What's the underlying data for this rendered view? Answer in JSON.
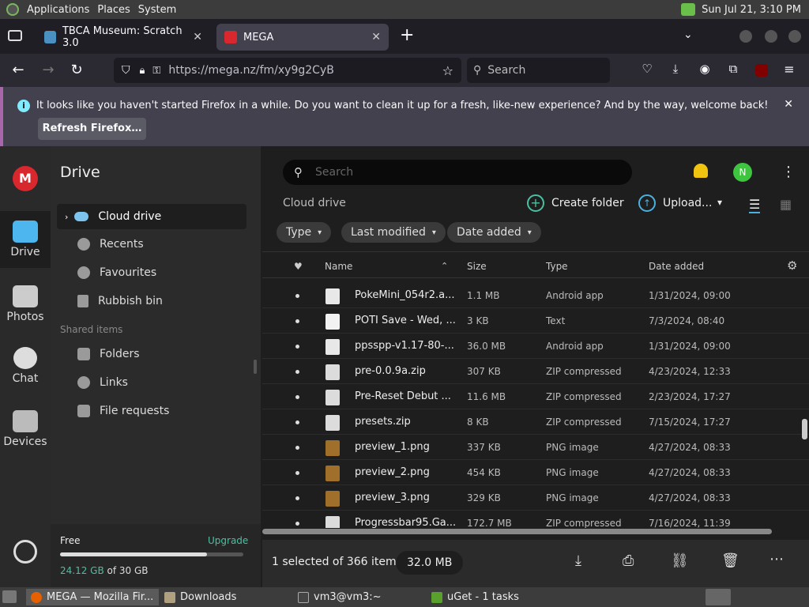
{
  "top_panel": {
    "menus": [
      "Applications",
      "Places",
      "System"
    ],
    "clock": "Sun Jul 21,  3:10 PM"
  },
  "tabs": [
    {
      "title": "TBCA Museum: Scratch 3.0",
      "favicon_color": "#4a90c2"
    },
    {
      "title": "MEGA",
      "favicon_color": "#d9272e"
    }
  ],
  "nav": {
    "url": "https://mega.nz/fm/xy9g2CyB",
    "search_placeholder": "Search"
  },
  "notification": {
    "message": "It looks like you haven't started Firefox in a while. Do you want to clean it up for a fresh, like-new experience? And by the way, welcome back!",
    "button": "Refresh Firefox…"
  },
  "mega": {
    "accent": "#d9272e",
    "iconbar": [
      "Drive",
      "Photos",
      "Chat",
      "Devices"
    ],
    "sidebar_title": "Drive",
    "sidebar_items": [
      "Cloud drive",
      "Recents",
      "Favourites",
      "Rubbish bin"
    ],
    "shared_header": "Shared items",
    "shared_items": [
      "Folders",
      "Links",
      "File requests"
    ],
    "storage": {
      "plan": "Free",
      "upgrade": "Upgrade",
      "used": "24.12 GB",
      "of": "of 30 GB",
      "fraction": 0.8
    },
    "search_placeholder": "Search",
    "avatar_letter": "N",
    "breadcrumb": "Cloud drive",
    "create_folder": "Create folder",
    "upload": "Upload...",
    "filters": [
      "Type",
      "Last modified",
      "Date added"
    ],
    "columns": {
      "name": "Name",
      "size": "Size",
      "type": "Type",
      "date": "Date added"
    },
    "files": [
      {
        "name": "PokeMini_054r2.a...",
        "size": "1.1 MB",
        "type": "Android app",
        "date": "1/31/2024, 09:00",
        "icon": "android"
      },
      {
        "name": "POTI Save - Wed, ...",
        "size": "3 KB",
        "type": "Text",
        "date": "7/3/2024, 08:40",
        "icon": "text"
      },
      {
        "name": "ppsspp-v1.17-80-...",
        "size": "36.0 MB",
        "type": "Android app",
        "date": "1/31/2024, 09:00",
        "icon": "android"
      },
      {
        "name": "pre-0.0.9a.zip",
        "size": "307 KB",
        "type": "ZIP compressed",
        "date": "4/23/2024, 12:33",
        "icon": "zip"
      },
      {
        "name": "Pre-Reset Debut ...",
        "size": "11.6 MB",
        "type": "ZIP compressed",
        "date": "2/23/2024, 17:27",
        "icon": "zip"
      },
      {
        "name": "presets.zip",
        "size": "8 KB",
        "type": "ZIP compressed",
        "date": "7/15/2024, 17:27",
        "icon": "zip"
      },
      {
        "name": "preview_1.png",
        "size": "337 KB",
        "type": "PNG image",
        "date": "4/27/2024, 08:33",
        "icon": "image"
      },
      {
        "name": "preview_2.png",
        "size": "454 KB",
        "type": "PNG image",
        "date": "4/27/2024, 08:33",
        "icon": "image"
      },
      {
        "name": "preview_3.png",
        "size": "329 KB",
        "type": "PNG image",
        "date": "4/27/2024, 08:33",
        "icon": "image"
      },
      {
        "name": "Progressbar95.Ga...",
        "size": "172.7 MB",
        "type": "ZIP compressed",
        "date": "7/16/2024, 11:39",
        "icon": "zip"
      }
    ],
    "selection": "1 selected of 366 items",
    "selection_size": "32.0 MB"
  },
  "taskbar": [
    {
      "label": "MEGA — Mozilla Fir...",
      "color": "#e66000"
    },
    {
      "label": "Downloads",
      "color": "#b0a080"
    },
    {
      "label": "vm3@vm3:~",
      "color": "#444"
    },
    {
      "label": "uGet - 1 tasks",
      "color": "#5aa02c"
    }
  ]
}
